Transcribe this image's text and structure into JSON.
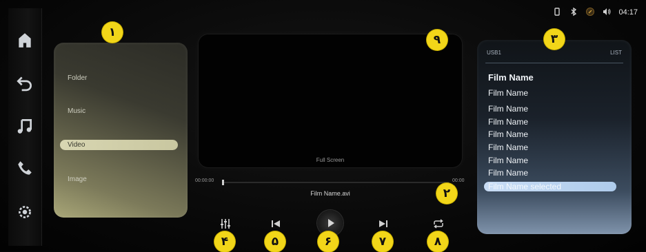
{
  "status_bar": {
    "time": "04:17",
    "icons": [
      "usb-icon",
      "bluetooth-icon",
      "nav-icon",
      "volume-icon"
    ]
  },
  "nav_rail": {
    "icons": [
      "home-icon",
      "back-icon",
      "music-icon",
      "phone-icon",
      "settings-icon"
    ]
  },
  "categories": {
    "items": [
      {
        "label": "Folder",
        "selected": false
      },
      {
        "label": "Music",
        "selected": false
      },
      {
        "label": "Video",
        "selected": true
      },
      {
        "label": "Image",
        "selected": false
      }
    ]
  },
  "player": {
    "fullscreen_label": "Full Screen",
    "elapsed": "00:00:00",
    "total": "00:00",
    "progress": 0,
    "filename": "Film Name.avi",
    "controls": [
      "equalizer-icon",
      "previous-icon",
      "play-icon",
      "next-icon",
      "repeat-icon"
    ]
  },
  "playlist": {
    "source": "USB1",
    "list_label": "LIST",
    "items": [
      "Film Name",
      "Film Name",
      "Film Name",
      "Film Name",
      "Film Name",
      "Film Name",
      "Film Name",
      "Film Name",
      "Film Name selected"
    ],
    "selected_index": 8
  },
  "callouts": [
    "۱",
    "۲",
    "۳",
    "۴",
    "۵",
    "۶",
    "۷",
    "۸",
    "۹"
  ],
  "colors": {
    "callout": "#f2d619",
    "video_selected": "#d8d6b2",
    "list_selected": "#c9ddf5"
  }
}
